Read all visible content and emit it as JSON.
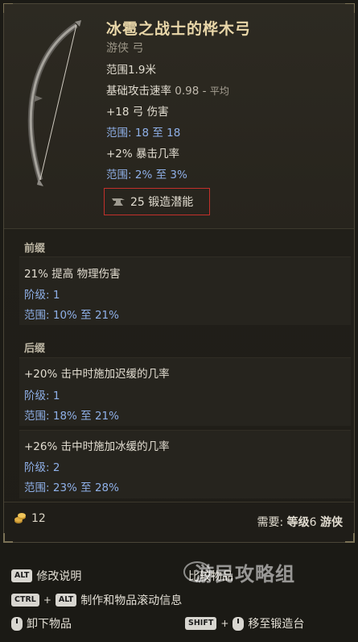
{
  "item": {
    "name": "冰雹之战士的桦木弓",
    "type": "游侠 弓",
    "stats": {
      "range": "范围1.9米",
      "attack_speed_label": "基础攻击速率",
      "attack_speed_value": "0.98",
      "attack_speed_sep": "-",
      "attack_speed_tag": "平均",
      "bow_damage": "+18 弓 伤害",
      "bow_damage_range_key": "范围:",
      "bow_damage_range_from": "18",
      "bow_damage_range_to_word": "至",
      "bow_damage_range_to": "18",
      "crit": "+2% 暴击几率",
      "crit_range_key": "范围:",
      "crit_range_from": "2%",
      "crit_range_to_word": "至",
      "crit_range_to": "3%"
    },
    "forge_potential": "25 锻造潜能"
  },
  "prefix": {
    "title": "前缀",
    "affixes": [
      {
        "text": "21% 提高 物理伤害",
        "tier_key": "阶级:",
        "tier": "1",
        "range_key": "范围:",
        "range_from": "10%",
        "range_to_word": "至",
        "range_to": "21%"
      }
    ]
  },
  "suffix": {
    "title": "后缀",
    "affixes": [
      {
        "text": "+20% 击中时施加迟缓的几率",
        "tier_key": "阶级:",
        "tier": "1",
        "range_key": "范围:",
        "range_from": "18%",
        "range_to_word": "至",
        "range_to": "21%"
      },
      {
        "text": "+26% 击中时施加冰缓的几率",
        "tier_key": "阶级:",
        "tier": "2",
        "range_key": "范围:",
        "range_from": "23%",
        "range_to_word": "至",
        "range_to": "28%"
      }
    ]
  },
  "footer": {
    "gold": "12",
    "requirement_label": "需要:",
    "level_label": "等级",
    "level_value": "6",
    "class": "游侠"
  },
  "controls": {
    "alt_key": "ALT",
    "modify_desc": "修改说明",
    "compare_label": "比较物品",
    "ctrl_key": "CTRL",
    "plus": "+",
    "craft_scroll": "制作和物品滚动信息",
    "unequip": "卸下物品",
    "shift_key": "SHIFT",
    "move_forge": "移至锻造台"
  },
  "watermark": "游民攻略组",
  "colors": {
    "title": "#e9d7a9",
    "key_blue": "#8fb0e8",
    "forge_border": "#c2302b",
    "panel_bg": "#211f19"
  }
}
